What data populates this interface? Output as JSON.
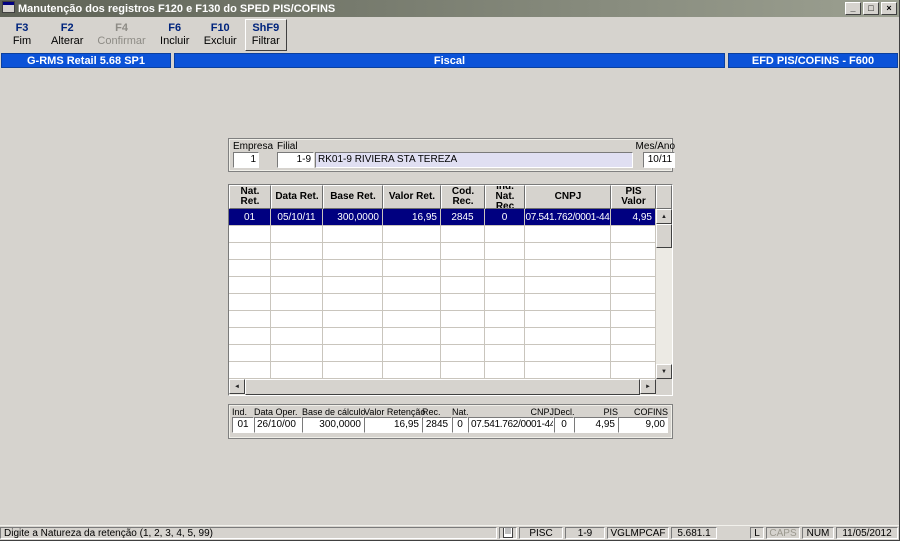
{
  "window": {
    "title": "Manutenção dos registros F120 e F130 do SPED PIS/COFINS"
  },
  "icons": {
    "minimize": "_",
    "maximize": "□",
    "close": "×",
    "arrow_up": "▲",
    "arrow_down": "▼",
    "arrow_left": "◄",
    "arrow_right": "►"
  },
  "colors": {
    "header_blue": "#0b52d8",
    "selection_navy": "#000080",
    "filial_field_bg": "#e0dff2",
    "desktop_gray": "#d6d3ce"
  },
  "toolbar": {
    "buttons": [
      {
        "key": "F3",
        "label": "Fim",
        "enabled": true
      },
      {
        "key": "F2",
        "label": "Alterar",
        "enabled": true
      },
      {
        "key": "F4",
        "label": "Confirmar",
        "enabled": false
      },
      {
        "key": "F6",
        "label": "Incluir",
        "enabled": true
      },
      {
        "key": "F10",
        "label": "Excluir",
        "enabled": true
      },
      {
        "key": "ShF9",
        "label": "Filtrar",
        "enabled": true
      }
    ]
  },
  "header": {
    "product": "G-RMS Retail 5.68 SP1",
    "module": "Fiscal",
    "screen": "EFD PIS/COFINS - F600"
  },
  "filter": {
    "empresa_label": "Empresa",
    "empresa_value": "1",
    "filial_label": "Filial",
    "filial_code": "1-9",
    "filial_name": "RK01-9 RIVIERA STA TEREZA",
    "mesano_label": "Mes/Ano",
    "mesano_value": "10/11"
  },
  "grid": {
    "columns": [
      "Nat. Ret.",
      "Data Ret.",
      "Base Ret.",
      "Valor Ret.",
      "Cod. Rec.",
      "Ind. Nat. Rec",
      "CNPJ",
      "PIS Valor"
    ],
    "rows": [
      [
        "01",
        "05/10/11",
        "300,0000",
        "16,95",
        "2845",
        "0",
        "07.541.762/0001-44",
        "4,95"
      ]
    ]
  },
  "editor": {
    "fields": [
      {
        "label": "Ind.",
        "value": "01"
      },
      {
        "label": "Data Oper.",
        "value": "26/10/00"
      },
      {
        "label": "Base de cálculo",
        "value": "300,0000"
      },
      {
        "label": "Valor Retenção",
        "value": "16,95"
      },
      {
        "label": "Rec.",
        "value": "2845"
      },
      {
        "label": "Nat.",
        "value": "0"
      },
      {
        "label": "CNPJ",
        "value": "07.541.762/0001-44"
      },
      {
        "label": "Decl.",
        "value": "0"
      },
      {
        "label": "PIS",
        "value": "4,95"
      },
      {
        "label": "COFINS",
        "value": "9,00"
      }
    ]
  },
  "statusbar": {
    "message": "Digite a Natureza da retenção (1, 2, 3, 4, 5, 99)",
    "panel_module": "PISC",
    "panel_filial": "1-9",
    "panel_user": "VGLMPCAF",
    "panel_version": "5.681.1",
    "indicator_l": "L",
    "indicator_caps": "CAPS",
    "indicator_num": "NUM",
    "date": "11/05/2012"
  }
}
